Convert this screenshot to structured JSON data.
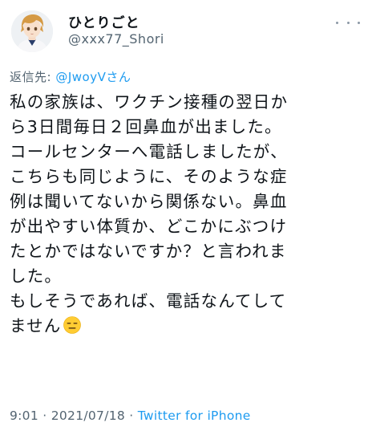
{
  "author": {
    "display_name": "ひとりごと",
    "handle": "@xxx77_Shori"
  },
  "reply": {
    "prefix": "返信先: ",
    "mention": "@JwoyVさん"
  },
  "tweet": {
    "lines": [
      "私の家族は、ワクチン接種の翌日か",
      "ら3日間毎日２回鼻血が出ました。",
      "コールセンターへ電話しましたが、",
      "こちらも同じように、そのような症",
      "例は聞いてないから関係ない。鼻血",
      "が出やすい体質か、どこかにぶつけ",
      "たとかではないですか？と言われま",
      "した。",
      "もしそうであれば、電話なんてして",
      "ません"
    ],
    "emoji": "expressionless-face-emoji"
  },
  "meta": {
    "time": "9:01",
    "separator1": " · ",
    "date": "2021/07/18",
    "separator2": " · ",
    "source": "Twitter for iPhone"
  },
  "colors": {
    "accent": "#1d9bf0",
    "secondary_text": "#536471",
    "primary_text": "#0f1419"
  }
}
